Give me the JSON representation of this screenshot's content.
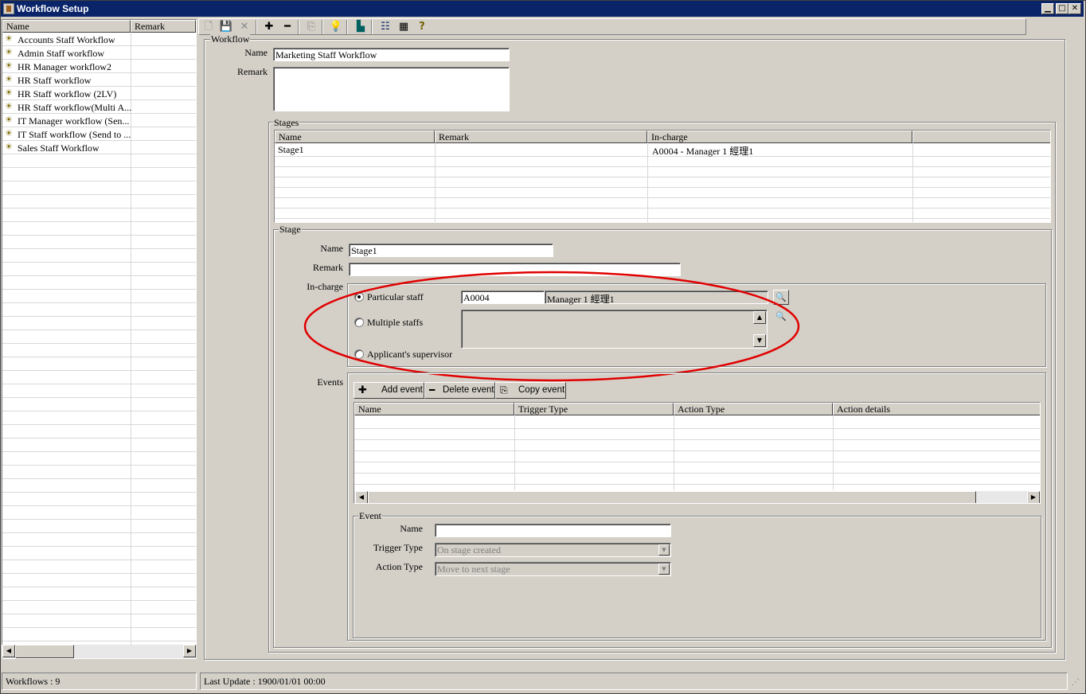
{
  "window": {
    "title": "Workflow Setup"
  },
  "left_list": {
    "columns": [
      "Name",
      "Remark"
    ],
    "items": [
      "Accounts Staff Workflow",
      "Admin Staff workflow",
      "HR Manager workflow2",
      "HR Staff workflow",
      "HR Staff workflow (2LV)",
      "HR Staff workflow(Multi A...",
      "IT Manager workflow (Sen...",
      "IT Staff workflow (Send to ...",
      "Sales Staff Workflow"
    ]
  },
  "toolbar": {
    "icons": [
      "new-icon",
      "save-icon",
      "delete-icon",
      "add-icon",
      "remove-icon",
      "copy-icon",
      "bulb-icon",
      "exit-icon",
      "tree-view-icon",
      "grid-view-icon",
      "help-icon"
    ]
  },
  "workflow": {
    "group_label": "Workflow",
    "name_label": "Name",
    "name_value": "Marketing Staff Workflow",
    "remark_label": "Remark",
    "remark_value": ""
  },
  "stages": {
    "group_label": "Stages",
    "columns": [
      "Name",
      "Remark",
      "In-charge",
      ""
    ],
    "rows": [
      {
        "name": "Stage1",
        "remark": "",
        "incharge": "A0004 - Manager 1 經理1"
      }
    ]
  },
  "stage": {
    "group_label": "Stage",
    "name_label": "Name",
    "name_value": "Stage1",
    "remark_label": "Remark",
    "remark_value": "",
    "incharge_label": "In-charge",
    "radio_particular": "Particular staff",
    "radio_multiple": "Multiple staffs",
    "radio_supervisor": "Applicant's supervisor",
    "staff_code": "A0004",
    "staff_name": "Manager 1 經理1",
    "selected_option": "Particular staff"
  },
  "events": {
    "label": "Events",
    "add_label": "Add event",
    "delete_label": "Delete event",
    "copy_label": "Copy event",
    "columns": [
      "Name",
      "Trigger Type",
      "Action Type",
      "Action details"
    ]
  },
  "event": {
    "group_label": "Event",
    "name_label": "Name",
    "name_value": "",
    "trigger_label": "Trigger Type",
    "trigger_value": "On stage created",
    "action_label": "Action Type",
    "action_value": "Move to next stage"
  },
  "statusbar": {
    "workflows": "Workflows : 9",
    "last_update": "Last Update :  1900/01/01 00:00"
  },
  "colors": {
    "titlebar": "#0a246a",
    "annotation": "#e00000",
    "face": "#d4d0c8"
  }
}
